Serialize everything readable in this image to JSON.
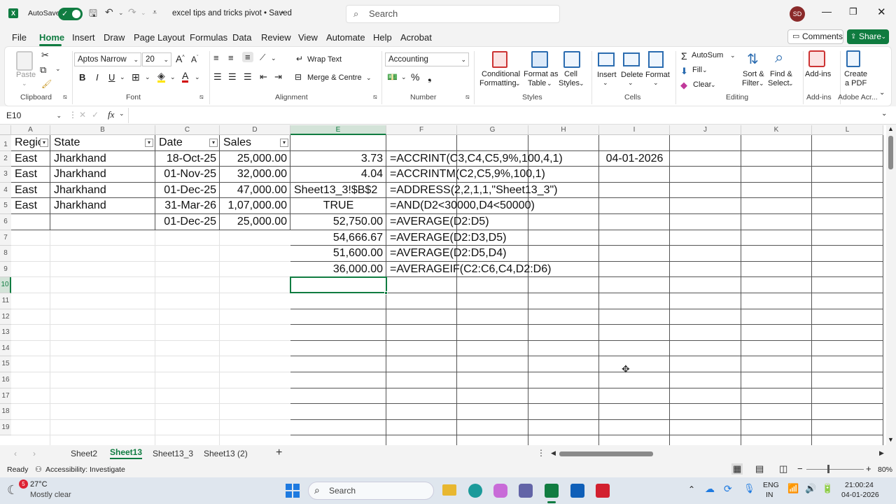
{
  "titlebar": {
    "autosave": "AutoSave",
    "autosave_state": "On",
    "title": "excel tips and tricks pivot • Saved",
    "search": "Search",
    "avatar": "SD"
  },
  "menu": [
    "File",
    "Home",
    "Insert",
    "Draw",
    "Page Layout",
    "Formulas",
    "Data",
    "Review",
    "View",
    "Automate",
    "Help",
    "Acrobat"
  ],
  "menu_active": "Home",
  "comments": "Comments",
  "share": "Share",
  "ribbon": {
    "paste": "Paste",
    "clipboard": "Clipboard",
    "font_name": "Aptos Narrow",
    "font_size": "20",
    "font": "Font",
    "wrap_text": "Wrap Text",
    "merge": "Merge & Centre",
    "alignment": "Alignment",
    "number_format": "Accounting",
    "number": "Number",
    "cond_fmt_1": "Conditional",
    "cond_fmt_2": "Formatting",
    "fmt_table_1": "Format as",
    "fmt_table_2": "Table",
    "cell_styles_1": "Cell",
    "cell_styles_2": "Styles",
    "styles": "Styles",
    "insert": "Insert",
    "delete": "Delete",
    "format": "Format",
    "cells": "Cells",
    "autosum": "AutoSum",
    "fill": "Fill",
    "clear": "Clear",
    "sort_1": "Sort &",
    "sort_2": "Filter",
    "find_1": "Find &",
    "find_2": "Select",
    "editing": "Editing",
    "addins": "Add-ins",
    "addins_group": "Add-ins",
    "pdf_1": "Create",
    "pdf_2": "a PDF",
    "adobe_group": "Adobe Acr..."
  },
  "namebox": "E10",
  "fx": "fx",
  "columns": [
    "A",
    "B",
    "C",
    "D",
    "E",
    "F",
    "G",
    "H",
    "I",
    "J",
    "K",
    "L"
  ],
  "rows": [
    "1",
    "2",
    "3",
    "4",
    "5",
    "6",
    "7",
    "8",
    "9",
    "10",
    "11",
    "12",
    "13",
    "14",
    "15",
    "16",
    "17",
    "18",
    "19"
  ],
  "cells": {
    "A1": "Regio",
    "B1": "State",
    "C1": "Date",
    "D1": "Sales",
    "A2": "East",
    "B2": "Jharkhand",
    "C2": "18-Oct-25",
    "D2": "25,000.00",
    "E2": "3.73",
    "F2": "=ACCRINT(C3,C4,C5,9%,100,4,1)",
    "I2": "04-01-2026",
    "A3": "East",
    "B3": "Jharkhand",
    "C3": "01-Nov-25",
    "D3": "32,000.00",
    "E3": "4.04",
    "F3": "=ACCRINTM(C2,C5,9%,100,1)",
    "A4": "East",
    "B4": "Jharkhand",
    "C4": "01-Dec-25",
    "D4": "47,000.00",
    "E4": "Sheet13_3!$B$2",
    "F4": "=ADDRESS(2,2,1,1,\"Sheet13_3\")",
    "A5": "East",
    "B5": "Jharkhand",
    "C5": "31-Mar-26",
    "D5": "1,07,000.00",
    "E5": "TRUE",
    "F5": "=AND(D2<30000,D4<50000)",
    "C6": "01-Dec-25",
    "D6": "25,000.00",
    "E6": "52,750.00",
    "F6": "=AVERAGE(D2:D5)",
    "E7": "54,666.67",
    "F7": "=AVERAGE(D2:D3,D5)",
    "E8": "51,600.00",
    "F8": "=AVERAGE(D2:D5,D4)",
    "E9": "36,000.00",
    "F9": "=AVERAGEIF(C2:C6,C4,D2:D6)"
  },
  "sheets": [
    "Sheet2",
    "Sheet13",
    "Sheet13_3",
    "Sheet13 (2)"
  ],
  "active_sheet": "Sheet13",
  "status": {
    "ready": "Ready",
    "accessibility": "Accessibility: Investigate",
    "zoom": "80%"
  },
  "taskbar": {
    "temp": "27°C",
    "weather": "Mostly clear",
    "badge": "5",
    "search": "Search",
    "lang1": "ENG",
    "lang2": "IN",
    "time": "21:00:24",
    "date": "04-01-2026"
  },
  "colors": {
    "excel_green": "#107c41",
    "selection": "#217346",
    "share": "#0f7b3f"
  }
}
